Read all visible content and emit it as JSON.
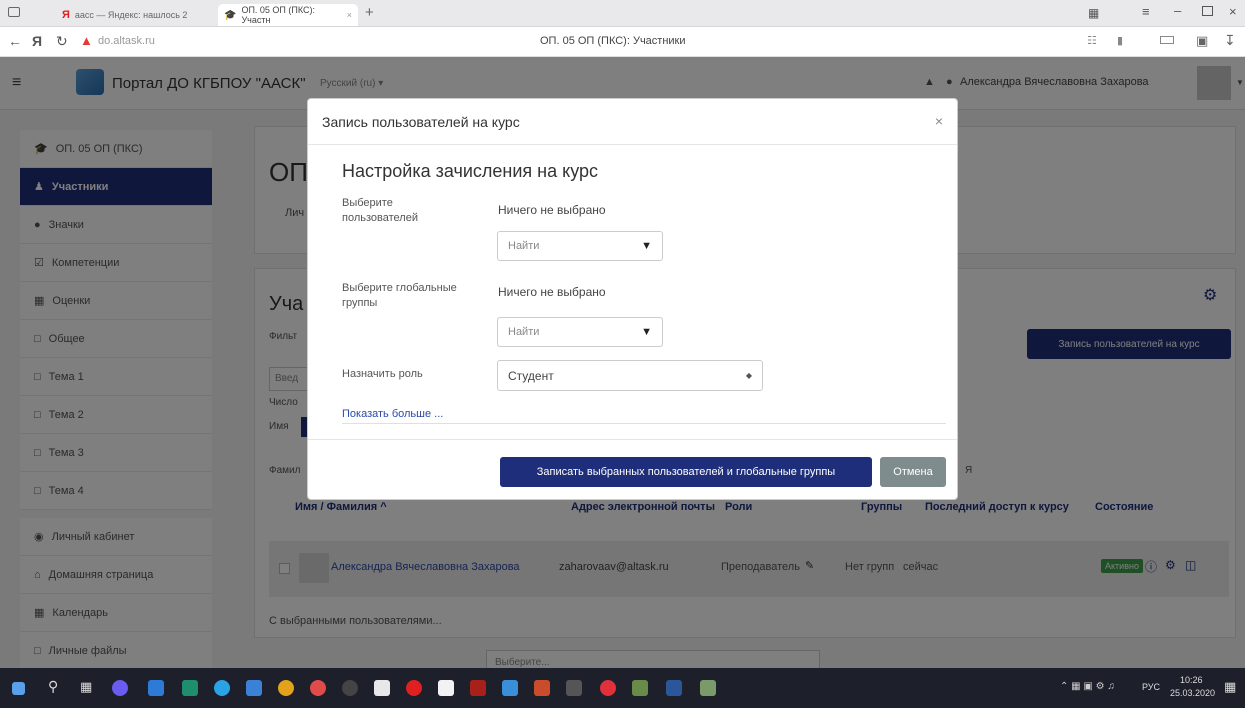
{
  "browser": {
    "tabs": [
      {
        "label": "аасс — Яндекс: нашлось 2"
      },
      {
        "label": "ОП. 05 ОП (ПКС): Участн"
      }
    ],
    "new_tab": "+",
    "address": "do.altask.ru",
    "page_title": "ОП. 05 ОП (ПКС): Участники"
  },
  "navbar": {
    "site_name": "Портал ДО КГБПОУ \"ААСК\"",
    "language": "Русский (ru) ▾",
    "user_name": "Александра Вячеславовна Захарова"
  },
  "sidebar": {
    "items": [
      {
        "label": "ОП. 05 ОП (ПКС)"
      },
      {
        "label": "Участники"
      },
      {
        "label": "Значки"
      },
      {
        "label": "Компетенции"
      },
      {
        "label": "Оценки"
      },
      {
        "label": "Общее"
      },
      {
        "label": "Тема 1"
      },
      {
        "label": "Тема 2"
      },
      {
        "label": "Тема 3"
      },
      {
        "label": "Тема 4"
      },
      {
        "label": "Личный кабинет"
      },
      {
        "label": "Домашняя страница"
      },
      {
        "label": "Календарь"
      },
      {
        "label": "Личные файлы"
      }
    ]
  },
  "course": {
    "heading_partial": "ОП",
    "sub_partial": "Лич"
  },
  "participants": {
    "heading_partial": "Уча",
    "filter_partial": "Фильт",
    "search_partial": "Введ",
    "count_partial": "Число",
    "name_partial": "Имя",
    "surname_partial": "Фамил",
    "letter": "Я",
    "enrol_button": "Запись пользователей на курс",
    "columns": [
      "Имя / Фамилия ^",
      "Адрес электронной почты",
      "Роли",
      "Группы",
      "Последний доступ к курсу",
      "Состояние"
    ],
    "row": {
      "name": "Александра Вячеславовна Захарова",
      "email": "zaharovaav@altask.ru",
      "role": "Преподаватель",
      "groups": "Нет групп",
      "last_access": "сейчас",
      "status": "Активно"
    },
    "bulk_label": "С выбранными пользователями...",
    "bulk_select": "Выберите..."
  },
  "modal": {
    "title": "Запись пользователей на курс",
    "subtitle": "Настройка зачисления на курс",
    "users_label": "Выберите пользователей",
    "users_value": "Ничего не выбрано",
    "users_search": "Найти",
    "groups_label": "Выберите глобальные группы",
    "groups_value": "Ничего не выбрано",
    "groups_search": "Найти",
    "role_label": "Назначить роль",
    "role_value": "Студент",
    "show_more": "Показать больше ...",
    "submit": "Записать выбранных пользователей и глобальные группы",
    "cancel": "Отмена"
  },
  "taskbar": {
    "lang": "РУС",
    "time": "10:26",
    "date": "25.03.2020"
  },
  "colors": {
    "primary": "#1f2e7a",
    "cancel": "#7f8c8d",
    "active_badge": "#3fa14a",
    "link": "#2a4aa8"
  }
}
